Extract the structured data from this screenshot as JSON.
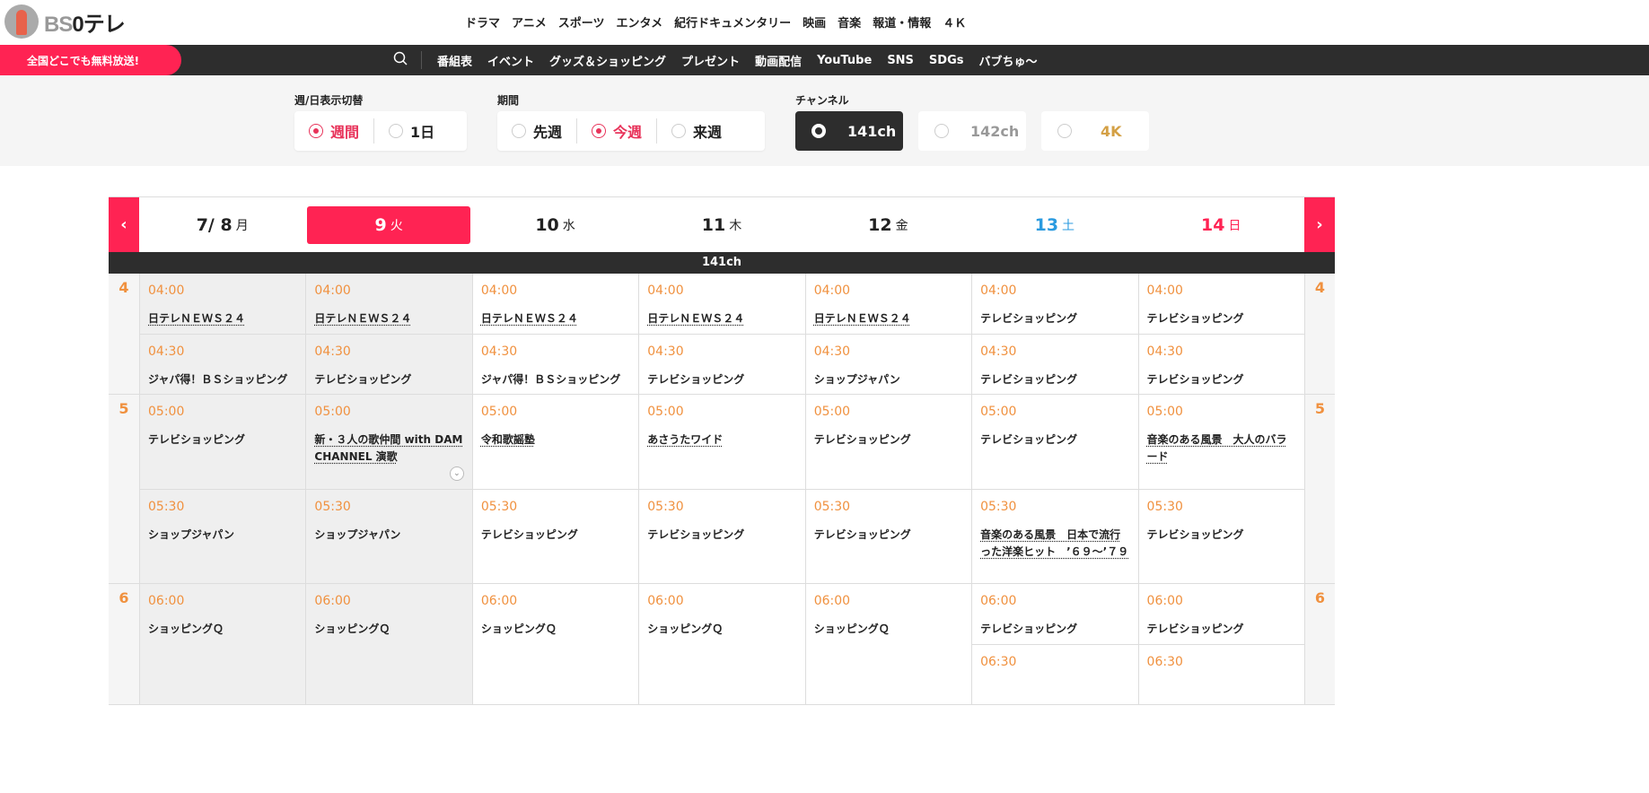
{
  "logo": {
    "text": "BS日テレ",
    "wm_a": "BS",
    "wm_b": "0テレ"
  },
  "global_nav": [
    "ドラマ",
    "アニメ",
    "スポーツ",
    "エンタメ",
    "紀行ドキュメンタリー",
    "映画",
    "音楽",
    "報道・情報",
    "４Ｋ"
  ],
  "promo": "全国どこでも無料放送!",
  "sub_nav": [
    "番組表",
    "イベント",
    "グッズ＆ショッピング",
    "プレゼント",
    "動画配信",
    "YouTube",
    "SNS",
    "SDGs",
    "バブちゅ～"
  ],
  "filters": {
    "view": {
      "label": "週/日表示切替",
      "options": [
        {
          "label": "週間",
          "selected": true
        },
        {
          "label": "1日",
          "selected": false
        }
      ]
    },
    "period": {
      "label": "期間",
      "options": [
        {
          "label": "先週",
          "selected": false
        },
        {
          "label": "今週",
          "selected": true
        },
        {
          "label": "来週",
          "selected": false
        }
      ]
    },
    "channel": {
      "label": "チャンネル",
      "options": [
        {
          "label": "141ch",
          "selected": true
        },
        {
          "label": "142ch",
          "selected": false
        },
        {
          "label": "4K",
          "selected": false
        }
      ]
    }
  },
  "colors": {
    "accent": "#ff2353",
    "time": "#f0913f",
    "sat": "#2b9be0",
    "dark": "#2d2d2d",
    "4k": "#d4a045"
  },
  "schedule": {
    "prev": "‹",
    "next": "›",
    "channel": "141ch",
    "days": [
      {
        "date": "7/ 8",
        "dow": "月",
        "type": "past"
      },
      {
        "date": "9",
        "dow": "火",
        "type": "active"
      },
      {
        "date": "10",
        "dow": "水",
        "type": ""
      },
      {
        "date": "11",
        "dow": "木",
        "type": ""
      },
      {
        "date": "12",
        "dow": "金",
        "type": ""
      },
      {
        "date": "13",
        "dow": "土",
        "type": "sat"
      },
      {
        "date": "14",
        "dow": "日",
        "type": "sun"
      }
    ],
    "hours": [
      {
        "hour": "4",
        "columns": [
          [
            {
              "time": "04:00",
              "title": "日テレＮＥＷＳ２４",
              "link": true,
              "min": 30
            },
            {
              "time": "04:30",
              "title": "ジャパ得！ＢＳショッピング",
              "min": 30
            }
          ],
          [
            {
              "time": "04:00",
              "title": "日テレＮＥＷＳ２４",
              "link": true,
              "min": 30
            },
            {
              "time": "04:30",
              "title": "テレビショッピング",
              "min": 30
            }
          ],
          [
            {
              "time": "04:00",
              "title": "日テレＮＥＷＳ２４",
              "link": true,
              "min": 30
            },
            {
              "time": "04:30",
              "title": "ジャパ得！ＢＳショッピング",
              "min": 30
            }
          ],
          [
            {
              "time": "04:00",
              "title": "日テレＮＥＷＳ２４",
              "link": true,
              "min": 30
            },
            {
              "time": "04:30",
              "title": "テレビショッピング",
              "min": 30
            }
          ],
          [
            {
              "time": "04:00",
              "title": "日テレＮＥＷＳ２４",
              "link": true,
              "min": 30
            },
            {
              "time": "04:30",
              "title": "ショップジャパン",
              "min": 30
            }
          ],
          [
            {
              "time": "04:00",
              "title": "テレビショッピング",
              "min": 30
            },
            {
              "time": "04:30",
              "title": "テレビショッピング",
              "min": 30
            }
          ],
          [
            {
              "time": "04:00",
              "title": "テレビショッピング",
              "min": 30
            },
            {
              "time": "04:30",
              "title": "テレビショッピング",
              "min": 30
            }
          ]
        ]
      },
      {
        "hour": "5",
        "columns": [
          [
            {
              "time": "05:00",
              "title": "テレビショッピング",
              "min": 30
            },
            {
              "time": "05:30",
              "title": "ショップジャパン",
              "min": 30
            }
          ],
          [
            {
              "time": "05:00",
              "title": "新・３人の歌仲間 with DAM CHANNEL 演歌",
              "link": true,
              "expand": true,
              "min": 30
            },
            {
              "time": "05:30",
              "title": "ショップジャパン",
              "min": 30
            }
          ],
          [
            {
              "time": "05:00",
              "title": "令和歌謡塾",
              "link": true,
              "min": 30
            },
            {
              "time": "05:30",
              "title": "テレビショッピング",
              "min": 30
            }
          ],
          [
            {
              "time": "05:00",
              "title": "あさうたワイド",
              "link": true,
              "min": 30
            },
            {
              "time": "05:30",
              "title": "テレビショッピング",
              "min": 30
            }
          ],
          [
            {
              "time": "05:00",
              "title": "テレビショッピング",
              "min": 30
            },
            {
              "time": "05:30",
              "title": "テレビショッピング",
              "min": 30
            }
          ],
          [
            {
              "time": "05:00",
              "title": "テレビショッピング",
              "min": 30
            },
            {
              "time": "05:30",
              "title": "音楽のある風景　日本で流行った洋楽ヒット　’６９～’７９",
              "link": true,
              "min": 30
            }
          ],
          [
            {
              "time": "05:00",
              "title": "音楽のある風景　大人のバラード",
              "link": true,
              "min": 30
            },
            {
              "time": "05:30",
              "title": "テレビショッピング",
              "min": 30
            }
          ]
        ]
      },
      {
        "hour": "6",
        "columns": [
          [
            {
              "time": "06:00",
              "title": "ショッピングＱ",
              "min": 60
            }
          ],
          [
            {
              "time": "06:00",
              "title": "ショッピングＱ",
              "min": 60
            }
          ],
          [
            {
              "time": "06:00",
              "title": "ショッピングＱ",
              "min": 60
            }
          ],
          [
            {
              "time": "06:00",
              "title": "ショッピングＱ",
              "min": 60
            }
          ],
          [
            {
              "time": "06:00",
              "title": "ショッピングＱ",
              "min": 60
            }
          ],
          [
            {
              "time": "06:00",
              "title": "テレビショッピング",
              "min": 30
            },
            {
              "time": "06:30",
              "title": "",
              "min": 30
            }
          ],
          [
            {
              "time": "06:00",
              "title": "テレビショッピング",
              "min": 30
            },
            {
              "time": "06:30",
              "title": "",
              "min": 30
            }
          ]
        ]
      }
    ]
  }
}
